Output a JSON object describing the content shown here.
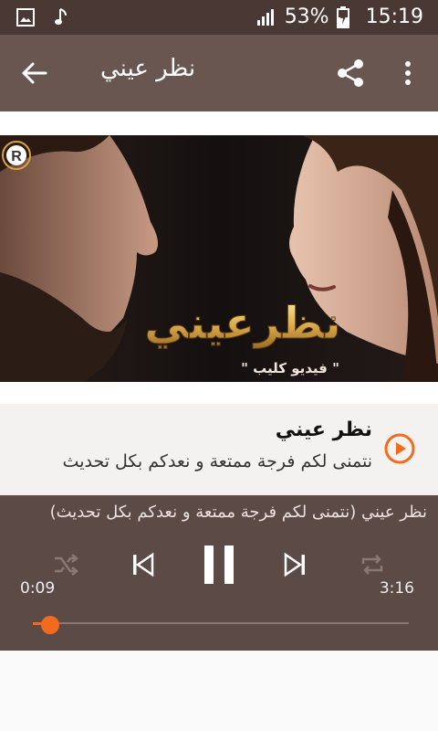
{
  "status_bar": {
    "battery": "53%",
    "time": "15:19"
  },
  "app_bar": {
    "title": "نظر عيني"
  },
  "hero": {
    "artwork_text": "نظرعيني",
    "artwork_caption": "\" فيديو كليب \"",
    "watermark_letter": "R"
  },
  "song": {
    "title": "نظر عيني",
    "subtitle": "نتمنى لكم فرجة ممتعة و نعدكم بكل تحديث"
  },
  "player": {
    "now_playing": "نظر عيني (نتمنى لكم فرجة ممتعة و نعدكم بكل تحديث)",
    "elapsed": "0:09",
    "duration": "3:16",
    "progress_fraction": 0.046,
    "accent_color": "#f26a1b"
  }
}
